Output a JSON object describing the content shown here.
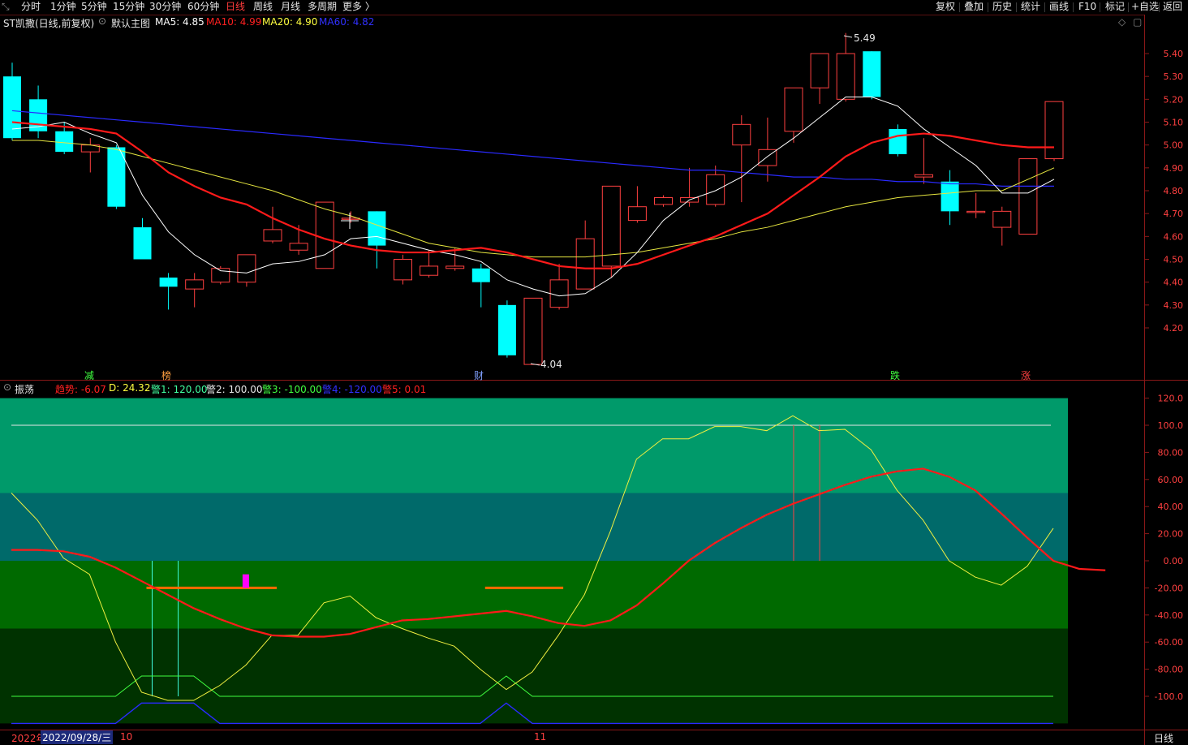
{
  "toolbar": {
    "periods": [
      "分时",
      "1分钟",
      "5分钟",
      "15分钟",
      "30分钟",
      "60分钟",
      "日线",
      "周线",
      "月线",
      "多周期",
      "更多 〉"
    ],
    "active_period": "日线",
    "right_buttons": [
      "复权",
      "叠加",
      "历史",
      "统计",
      "画线",
      "F10",
      "标记",
      "+自选",
      "返回"
    ]
  },
  "main_panel": {
    "title": "ST凯撒(日线,前复权)",
    "template": "默认主图",
    "indicators": [
      {
        "label": "MA5: 4.85",
        "color": "#ffffff"
      },
      {
        "label": "MA10: 4.99",
        "color": "#ff2020"
      },
      {
        "label": "MA20: 4.90",
        "color": "#ffff40"
      },
      {
        "label": "MA60: 4.82",
        "color": "#3030ff"
      }
    ],
    "high_label": "5.49",
    "low_label": "4.04",
    "event_markers": [
      {
        "text": "减",
        "color": "#40ff40",
        "candle": 3
      },
      {
        "text": "榜",
        "color": "#ffa040",
        "candle": 6
      },
      {
        "text": "财",
        "color": "#80a0ff",
        "candle": 18
      },
      {
        "text": "跌",
        "color": "#40ff40",
        "candle": 34
      },
      {
        "text": "涨",
        "color": "#ff4040",
        "candle": 39
      }
    ]
  },
  "sub_panel": {
    "name": "振荡",
    "indicators": [
      {
        "label": "趋势: -6.07",
        "color": "#ff2020"
      },
      {
        "label": "D: 24.32",
        "color": "#ffff40"
      },
      {
        "label": "警1: 120.00",
        "color": "#40ffa0"
      },
      {
        "label": "警2: 100.00",
        "color": "#e6e6e6"
      },
      {
        "label": "警3: -100.00",
        "color": "#40ff40"
      },
      {
        "label": "警4: -120.00",
        "color": "#3030ff"
      },
      {
        "label": "警5: 0.01",
        "color": "#ff2020"
      }
    ]
  },
  "date_axis": {
    "prefix": "2022年",
    "cursor_date": "2022/09/28/三",
    "months": [
      "10",
      "11"
    ]
  },
  "period_label": "日线",
  "chart_data": {
    "type": "candlestick",
    "price_axis": {
      "ticks": [
        "5.40",
        "5.30",
        "5.20",
        "5.10",
        "5.00",
        "4.90",
        "4.80",
        "4.70",
        "4.60",
        "4.50",
        "4.40",
        "4.30",
        "4.20"
      ]
    },
    "candles": [
      [
        5.3,
        5.03,
        5.36,
        5.02
      ],
      [
        5.2,
        5.06,
        5.26,
        5.03
      ],
      [
        5.06,
        4.97,
        5.1,
        4.96
      ],
      [
        4.97,
        5.0,
        5.03,
        4.88
      ],
      [
        4.99,
        4.73,
        5.0,
        4.72
      ],
      [
        4.64,
        4.5,
        4.68,
        4.5
      ],
      [
        4.42,
        4.38,
        4.44,
        4.28
      ],
      [
        4.37,
        4.41,
        4.44,
        4.29
      ],
      [
        4.4,
        4.46,
        4.47,
        4.39
      ],
      [
        4.4,
        4.52,
        4.52,
        4.38
      ],
      [
        4.58,
        4.63,
        4.73,
        4.57
      ],
      [
        4.54,
        4.57,
        4.65,
        4.52
      ],
      [
        4.46,
        4.75,
        4.75,
        4.46
      ],
      [
        4.68,
        4.68,
        4.71,
        4.66
      ],
      [
        4.71,
        4.56,
        4.71,
        4.46
      ],
      [
        4.41,
        4.5,
        4.52,
        4.39
      ],
      [
        4.43,
        4.47,
        4.54,
        4.42
      ],
      [
        4.46,
        4.47,
        4.55,
        4.45
      ],
      [
        4.46,
        4.4,
        4.48,
        4.29
      ],
      [
        4.3,
        4.08,
        4.32,
        4.07
      ],
      [
        4.04,
        4.33,
        4.33,
        4.04
      ],
      [
        4.29,
        4.41,
        4.48,
        4.28
      ],
      [
        4.37,
        4.59,
        4.67,
        4.37
      ],
      [
        4.47,
        4.82,
        4.82,
        4.42
      ],
      [
        4.67,
        4.73,
        4.82,
        4.66
      ],
      [
        4.74,
        4.77,
        4.78,
        4.73
      ],
      [
        4.75,
        4.77,
        4.9,
        4.73
      ],
      [
        4.74,
        4.87,
        4.91,
        4.73
      ],
      [
        5.0,
        5.09,
        5.13,
        4.75
      ],
      [
        4.91,
        4.98,
        5.12,
        4.84
      ],
      [
        5.06,
        5.25,
        5.25,
        5.01
      ],
      [
        5.25,
        5.4,
        5.4,
        5.18
      ],
      [
        5.2,
        5.4,
        5.49,
        5.19
      ],
      [
        5.41,
        5.21,
        5.41,
        5.2
      ],
      [
        5.07,
        4.96,
        5.09,
        4.95
      ],
      [
        4.86,
        4.87,
        5.03,
        4.83
      ],
      [
        4.84,
        4.71,
        4.89,
        4.65
      ],
      [
        4.71,
        4.71,
        4.79,
        4.68
      ],
      [
        4.64,
        4.71,
        4.73,
        4.56
      ],
      [
        4.61,
        4.94,
        4.94,
        4.61
      ],
      [
        4.94,
        5.19,
        5.19,
        4.93
      ]
    ],
    "ma5": [
      5.07,
      5.08,
      5.1,
      5.05,
      5.01,
      4.78,
      4.62,
      4.52,
      4.45,
      4.44,
      4.48,
      4.49,
      4.52,
      4.59,
      4.6,
      4.57,
      4.54,
      4.52,
      4.49,
      4.41,
      4.37,
      4.34,
      4.35,
      4.42,
      4.53,
      4.67,
      4.76,
      4.8,
      4.86,
      4.95,
      5.03,
      5.12,
      5.21,
      5.21,
      5.17,
      5.07,
      4.99,
      4.91,
      4.79,
      4.79,
      4.85
    ],
    "ma10": [
      5.1,
      5.09,
      5.08,
      5.07,
      5.05,
      4.97,
      4.88,
      4.82,
      4.77,
      4.74,
      4.68,
      4.63,
      4.59,
      4.56,
      4.54,
      4.53,
      4.53,
      4.54,
      4.55,
      4.53,
      4.5,
      4.47,
      4.46,
      4.46,
      4.48,
      4.52,
      4.56,
      4.6,
      4.65,
      4.7,
      4.78,
      4.86,
      4.95,
      5.01,
      5.04,
      5.05,
      5.04,
      5.02,
      5.0,
      4.99,
      4.99
    ],
    "ma20": [
      5.02,
      5.02,
      5.01,
      5.0,
      4.98,
      4.95,
      4.92,
      4.89,
      4.86,
      4.83,
      4.8,
      4.76,
      4.72,
      4.69,
      4.65,
      4.61,
      4.57,
      4.55,
      4.53,
      4.52,
      4.51,
      4.51,
      4.51,
      4.52,
      4.53,
      4.55,
      4.57,
      4.59,
      4.62,
      4.64,
      4.67,
      4.7,
      4.73,
      4.75,
      4.77,
      4.78,
      4.79,
      4.8,
      4.8,
      4.85,
      4.9
    ],
    "ma60": [
      5.15,
      5.14,
      5.13,
      5.12,
      5.11,
      5.1,
      5.09,
      5.08,
      5.07,
      5.06,
      5.05,
      5.04,
      5.03,
      5.02,
      5.01,
      5.0,
      4.99,
      4.98,
      4.97,
      4.96,
      4.95,
      4.94,
      4.93,
      4.92,
      4.91,
      4.9,
      4.89,
      4.89,
      4.88,
      4.87,
      4.86,
      4.86,
      4.85,
      4.85,
      4.84,
      4.84,
      4.83,
      4.83,
      4.82,
      4.82,
      4.82
    ],
    "oscillator": {
      "y_ticks": [
        "120.0",
        "100.0",
        "80.00",
        "60.00",
        "40.00",
        "20.00",
        "0.00",
        "-20.00",
        "-40.00",
        "-60.00",
        "-80.00",
        "-100.0"
      ],
      "bands": [
        {
          "from": 50,
          "to": 120,
          "color": "#009a6a"
        },
        {
          "from": 0,
          "to": 50,
          "color": "#006a6a"
        },
        {
          "from": -50,
          "to": 0,
          "color": "#006a00"
        },
        {
          "from": -120,
          "to": -50,
          "color": "#003200"
        }
      ],
      "trend": [
        8,
        8,
        7,
        3,
        -5,
        -15,
        -25,
        -35,
        -43,
        -50,
        -55,
        -56,
        -56,
        -54,
        -49,
        -44,
        -43,
        -41,
        -39,
        -37,
        -41,
        -46,
        -48,
        -44,
        -33,
        -17,
        0,
        13,
        24,
        34,
        42,
        49,
        56,
        62,
        66,
        68,
        62,
        52,
        35,
        17,
        0,
        -6,
        -7
      ],
      "d": [
        50,
        30,
        2,
        -10,
        -60,
        -97,
        -103,
        -103,
        -92,
        -77,
        -55,
        -55,
        -31,
        -26,
        -42,
        -50,
        -57,
        -63,
        -80,
        -95,
        -82,
        -55,
        -25,
        22,
        75,
        90,
        90,
        99,
        99,
        96,
        107,
        96,
        97,
        82,
        52,
        30,
        0,
        -12,
        -18,
        -4,
        24
      ],
      "warn3": [
        -100,
        -100,
        -100,
        -100,
        -100,
        -85,
        -85,
        -85,
        -100,
        -100,
        -100,
        -100,
        -100,
        -100,
        -100,
        -100,
        -100,
        -100,
        -100,
        -85,
        -100,
        -100,
        -100,
        -100,
        -100,
        -100,
        -100,
        -100,
        -100,
        -100,
        -100,
        -100,
        -100,
        -100,
        -100,
        -100,
        -100,
        -100,
        -100,
        -100,
        -100
      ],
      "warn4": [
        -120,
        -120,
        -120,
        -120,
        -120,
        -105,
        -105,
        -105,
        -120,
        -120,
        -120,
        -120,
        -120,
        -120,
        -120,
        -120,
        -120,
        -120,
        -120,
        -105,
        -120,
        -120,
        -120,
        -120,
        -120,
        -120,
        -120,
        -120,
        -120,
        -120,
        -120,
        -120,
        -120,
        -120,
        -120,
        -120,
        -120,
        -120,
        -120,
        -120,
        -120
      ],
      "orange_segments": [
        [
          5,
          10,
          -20
        ],
        [
          18,
          21,
          -20
        ]
      ],
      "magenta_bar": {
        "index": 9,
        "from": -20,
        "to": -10
      },
      "red_vlines": [
        30,
        31
      ],
      "cyan_vlines": [
        5,
        6
      ]
    }
  }
}
